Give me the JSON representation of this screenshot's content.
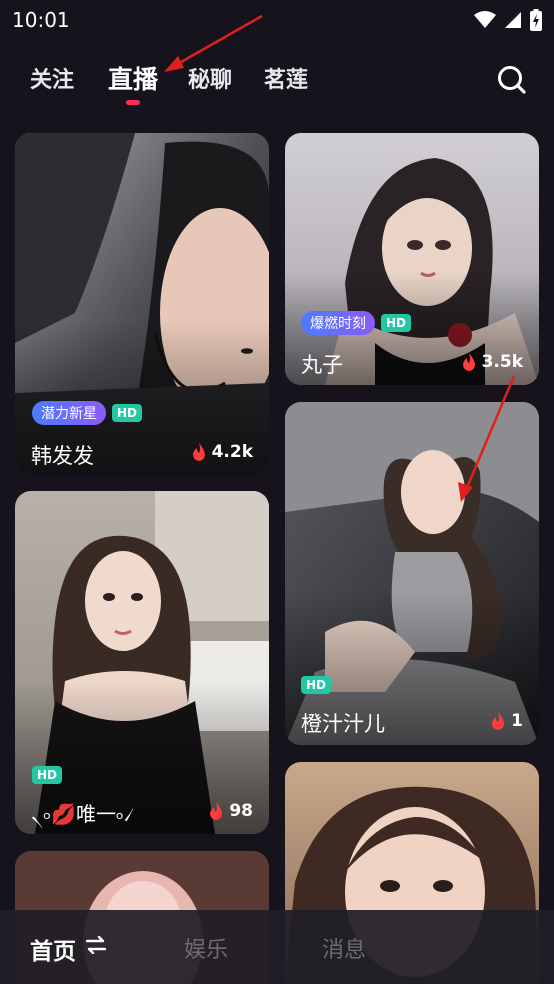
{
  "status_bar": {
    "time": "10:01"
  },
  "top_tabs": {
    "items": [
      {
        "label": "关注"
      },
      {
        "label": "直播"
      },
      {
        "label": "秘聊"
      },
      {
        "label": "茗莲"
      }
    ],
    "active_index": 1
  },
  "cards": [
    {
      "name": "韩发发",
      "tag": "潜力新星",
      "hd": "HD",
      "heat": "4.2k"
    },
    {
      "name": "丸子",
      "tag": "爆燃时刻",
      "hd": "HD",
      "heat": "3.5k"
    },
    {
      "name": "橙汁汁儿",
      "hd": "HD",
      "heat": "1"
    },
    {
      "name": "৲৹💋唯一৹৴",
      "hd": "HD",
      "heat": "98"
    }
  ],
  "bottom_nav": {
    "items": [
      {
        "label": "首页"
      },
      {
        "label": "娱乐"
      },
      {
        "label": "消息"
      }
    ],
    "active_index": 0
  },
  "colors": {
    "background": "#17131c",
    "accent_indicator": "#ff2d55",
    "hd_badge": "#22c7a3",
    "flame": "#ff3b3b",
    "annotation_arrow": "#e0201c"
  }
}
